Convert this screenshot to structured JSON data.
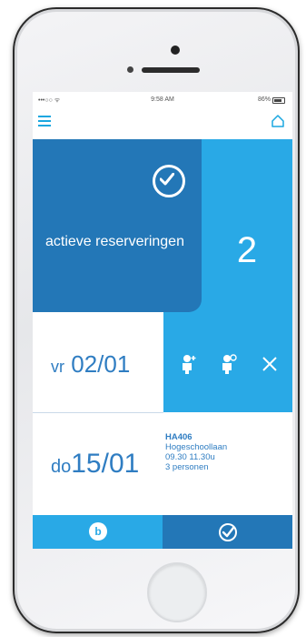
{
  "status_bar": {
    "signal": "•••○○ ᯤ",
    "time": "9:58 AM",
    "battery": "86%"
  },
  "navbar": {
    "menu_icon": "menu-icon",
    "home_icon": "home-icon"
  },
  "summary": {
    "label": "actieve reserveringen",
    "count": "2",
    "icon": "check-circle-icon"
  },
  "reservations": [
    {
      "day": "vr",
      "date": "02/01",
      "actions": [
        "add-person-icon",
        "person-info-icon",
        "close-icon"
      ]
    },
    {
      "day": "do",
      "date": "15/01",
      "room": "HA406",
      "location": "Hogeschoollaan",
      "time": "09.30 11.30u",
      "people": "3 personen"
    }
  ],
  "tabs": [
    {
      "name": "booking",
      "icon": "b-logo-icon",
      "glyph": "b",
      "color": "#29a9e6"
    },
    {
      "name": "reservations",
      "icon": "check-icon",
      "color": "#2377b7"
    }
  ],
  "colors": {
    "light_blue": "#29a9e6",
    "dark_blue": "#2377b7",
    "text_blue": "#2f7dc2"
  }
}
